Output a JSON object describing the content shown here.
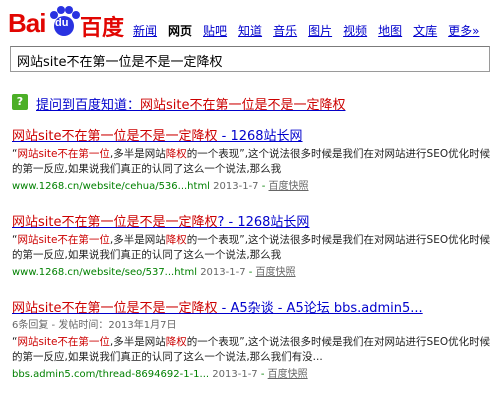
{
  "logo": {
    "left": "Bai",
    "inner": "du",
    "right": "百度"
  },
  "nav": [
    "新闻",
    "网页",
    "贴吧",
    "知道",
    "音乐",
    "图片",
    "视频",
    "地图",
    "文库",
    "更多»"
  ],
  "search": {
    "value": "网站site不在第一位是不是一定降权"
  },
  "zhidao": {
    "icon": "?",
    "prefix": "提问到百度知道：",
    "question": "网站site不在第一位是不是一定降权"
  },
  "results": [
    {
      "title_red": "网站site不在第一位是不是一定降权",
      "title_rest": " - 1268站长网",
      "abs_q1": "“",
      "abs_red1": "网站site不在第一位",
      "abs_mid1": ",多半是网站",
      "abs_red2": "降权",
      "abs_rest": "的一个表现”,这个说法很多时候是我们在对网站进行SEO优化时候的第一反应,如果说我们真正的认同了这么一个说法,那么我",
      "url": "www.1268.cn/website/cehua/536...html",
      "date": "2013-1-7",
      "snapshot": "百度快照"
    },
    {
      "title_red": "网站site不在第一位是不是一定降权",
      "title_rest": "? - 1268站长网",
      "abs_q1": "“",
      "abs_red1": "网站site不在第一位",
      "abs_mid1": ",多半是网站",
      "abs_red2": "降权",
      "abs_rest": "的一个表现”,这个说法很多时候是我们在对网站进行SEO优化时候的第一反应,如果说我们真正的认同了这么一个说法,那么我",
      "url": "www.1268.cn/website/seo/537...html",
      "date": "2013-1-7",
      "snapshot": "百度快照"
    },
    {
      "title_red": "网站site不在第一位是不是一定降权",
      "title_rest": " - A5杂谈 - A5论坛 bbs.admin5...",
      "meta": "6条回复 - 发帖时间：2013年1月7日",
      "abs_q1": "“",
      "abs_red1": "网站site不在第一位",
      "abs_mid1": ",多半是网站",
      "abs_red2": "降权",
      "abs_rest": "的一个表现”,这个说法很多时候是我们在对网站进行SEO优化时候的第一反应,如果说我们真正的认同了这么一个说法,那么我们有没...",
      "url": "bbs.admin5.com/thread-8694692-1-1...",
      "date": "2013-1-7",
      "snapshot": "百度快照"
    }
  ]
}
